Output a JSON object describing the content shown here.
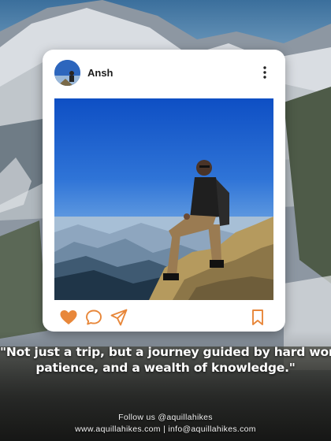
{
  "post": {
    "username": "Ansh",
    "icons": {
      "avatar": "profile-photo",
      "more": "more-vertical-icon",
      "like": "heart-icon",
      "comment": "comment-bubble-icon",
      "share": "send-paper-plane-icon",
      "save": "bookmark-icon"
    },
    "like_color": "#e8873a",
    "action_color": "#e8873a"
  },
  "quote": {
    "line1": "\"Not just a trip, but a journey guided by hard work,",
    "line2": "patience, and a wealth of knowledge.\""
  },
  "footer": {
    "follow": "Follow us @aquillahikes",
    "website": "www.aquillahikes.com",
    "separator": "|",
    "email": "info@aquillahikes.com"
  }
}
